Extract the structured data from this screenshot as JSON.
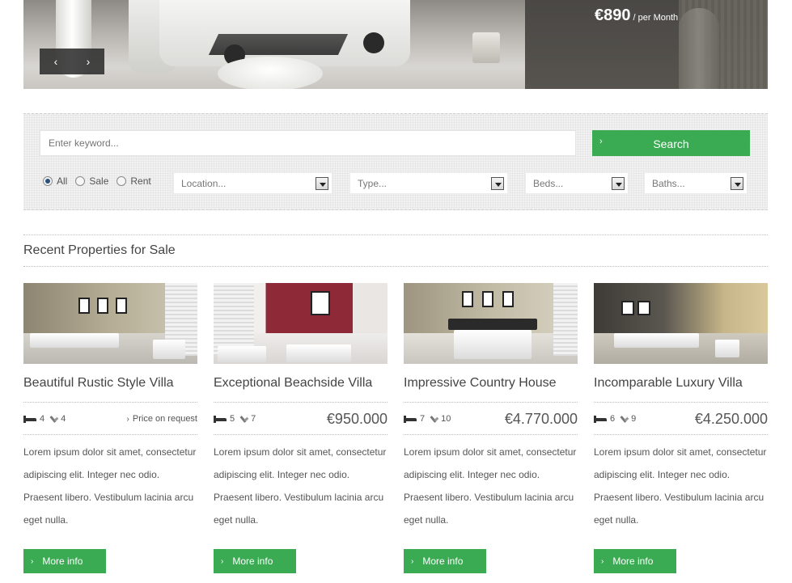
{
  "hero": {
    "price_amount": "€890",
    "price_period": "/ per Month",
    "prev_symbol": "‹",
    "next_symbol": "›"
  },
  "search": {
    "keyword_placeholder": "Enter keyword...",
    "button_label": "Search",
    "radios": [
      {
        "label": "All",
        "checked": true
      },
      {
        "label": "Sale",
        "checked": false
      },
      {
        "label": "Rent",
        "checked": false
      }
    ],
    "location_label": "Location...",
    "type_label": "Type...",
    "beds_label": "Beds...",
    "baths_label": "Baths..."
  },
  "section": {
    "title": "Recent Properties for Sale"
  },
  "properties": [
    {
      "title": "Beautiful Rustic Style Villa",
      "beds": "4",
      "baths": "4",
      "price": "Price on request",
      "description": "Lorem ipsum dolor sit amet, consectetur adipiscing elit. Integer nec odio. Praesent libero. Vestibulum lacinia arcu eget nulla.",
      "button_label": "More info"
    },
    {
      "title": "Exceptional Beachside Villa",
      "beds": "5",
      "baths": "7",
      "price": "€950.000",
      "description": "Lorem ipsum dolor sit amet, consectetur adipiscing elit. Integer nec odio. Praesent libero. Vestibulum lacinia arcu eget nulla.",
      "button_label": "More info"
    },
    {
      "title": "Impressive Country House",
      "beds": "7",
      "baths": "10",
      "price": "€4.770.000",
      "description": "Lorem ipsum dolor sit amet, consectetur adipiscing elit. Integer nec odio. Praesent libero. Vestibulum lacinia arcu eget nulla.",
      "button_label": "More info"
    },
    {
      "title": "Incomparable Luxury Villa",
      "beds": "6",
      "baths": "9",
      "price": "€4.250.000",
      "description": "Lorem ipsum dolor sit amet, consectetur adipiscing elit. Integer nec odio. Praesent libero. Vestibulum lacinia arcu eget nulla.",
      "button_label": "More info"
    }
  ],
  "colors": {
    "accent": "#3aab52",
    "text": "#555555",
    "heading": "#444444"
  }
}
